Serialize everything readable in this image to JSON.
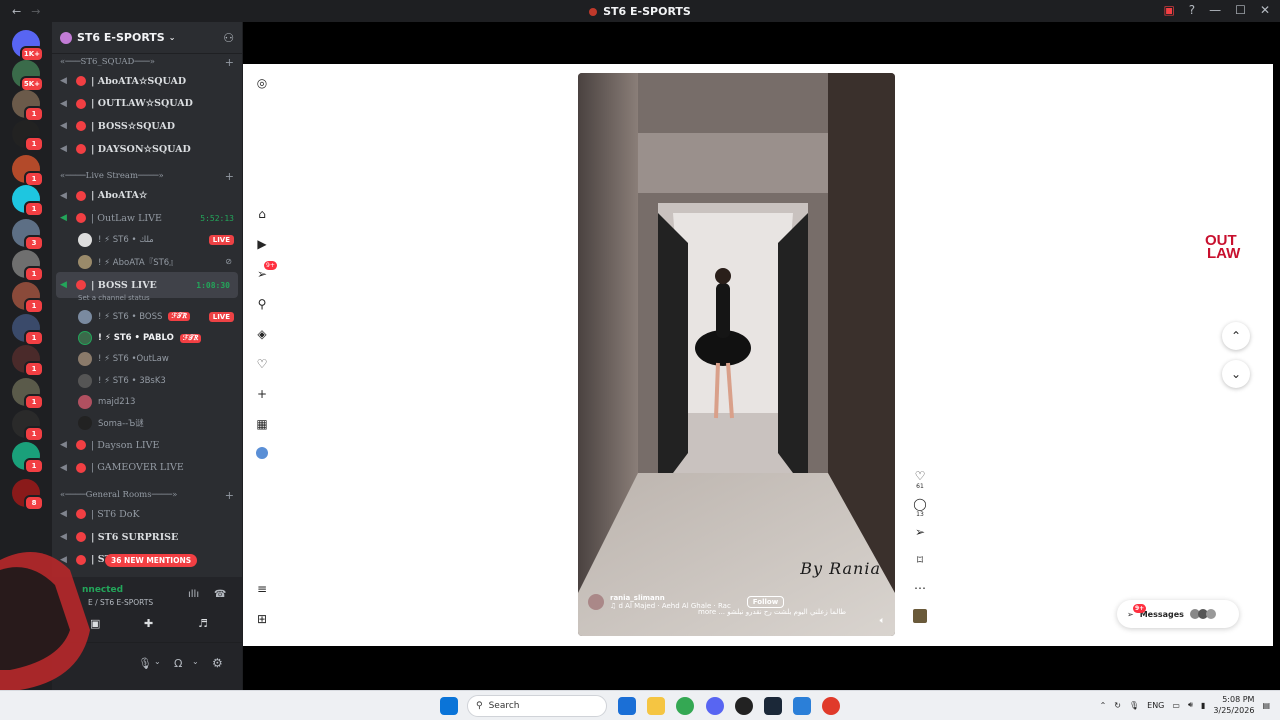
{
  "window": {
    "title": "ST6 E-SPORTS"
  },
  "server": {
    "name": "ST6 E-SPORTS"
  },
  "server_badges": [
    "1K+",
    "5K+",
    "1",
    "1",
    "1",
    "1",
    "3",
    "1",
    "1",
    "1",
    "1",
    "1",
    "1",
    "1",
    "8"
  ],
  "categories": {
    "squad": "«───ST6_SQUAD───»",
    "live": "«────Live Stream────»",
    "general": "«────General Rooms────»"
  },
  "squad_channels": [
    "| AboATA☆SQUAD",
    "| OUTLAW☆SQUAD",
    "| BOSS☆SQUAD",
    "| DAYSON☆SQUAD"
  ],
  "live_channels": [
    {
      "name": "| AboATA☆",
      "timer": ""
    },
    {
      "name": "| OutLaw LIVE",
      "timer": "5:52:13"
    }
  ],
  "outlaw_users": [
    {
      "name": "! ⚡ ST6 • ملك",
      "live": "LIVE"
    },
    {
      "name": "! ⚡ AboATA『ST6』",
      "live": ""
    }
  ],
  "boss_channel": {
    "name": "| BOSS LIVE",
    "timer": "1:08:30",
    "status": "Set a channel status"
  },
  "boss_users": [
    {
      "name": "! ⚡ ST6 • BOSS",
      "tag": "ℱ𝒯𝑅",
      "live": "LIVE"
    },
    {
      "name": "! ⚡ ST6 • PABLO",
      "tag": "ℱ𝒯𝑅",
      "live": ""
    },
    {
      "name": "! ⚡ ST6 •OutLaw",
      "tag": "",
      "live": ""
    },
    {
      "name": "! ⚡ ST6 • 3BsK3",
      "tag": "",
      "live": ""
    },
    {
      "name": "majd213",
      "tag": "",
      "live": ""
    },
    {
      "name": "Soma--Ъ谜",
      "tag": "",
      "live": ""
    }
  ],
  "more_live": [
    "| Dayson LIVE",
    "| GAMEOVER LIVE"
  ],
  "general_channels": [
    "| ST6 DoK",
    "| ST6 SURPRISE",
    "| ST6 NSHME"
  ],
  "mentions": "36 NEW MENTIONS",
  "voice": {
    "status": "nnected",
    "location": "E / ST6 E-SPORTS"
  },
  "instagram": {
    "notif_count": "9+",
    "reel": {
      "username": "rania_slimann",
      "audio": "♫ d Al Majed · Aehd Al Ghale · Rac",
      "follow": "Follow",
      "caption": "more ... طالما زعلني اليوم بلشت رح نقدرو نبلشو",
      "watermark": "By Rania"
    },
    "likes": "61",
    "comments": "13",
    "messages_label": "Messages",
    "messages_badge": "9+",
    "brand_logo": [
      "OUT",
      "LAW"
    ]
  },
  "taskbar": {
    "search_placeholder": "Search",
    "lang": "ENG",
    "time": "5:08 PM",
    "date": "3/25/2026"
  },
  "colors": {
    "discord_dark": "#1e1f22",
    "discord_panel": "#2b2d31",
    "red": "#f23f43",
    "green": "#23a55a"
  }
}
